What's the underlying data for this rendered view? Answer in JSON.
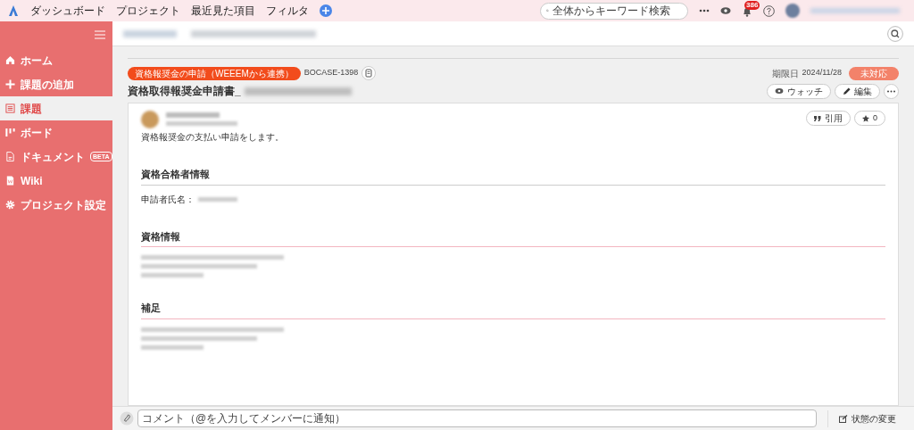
{
  "top_nav": {
    "items": [
      "ダッシュボード",
      "プロジェクト",
      "最近見た項目",
      "フィルタ"
    ],
    "search": {
      "placeholder": "全体からキーワード検索"
    },
    "notification_count": "386"
  },
  "sidebar": {
    "items": [
      {
        "label": "ホーム",
        "selected": false
      },
      {
        "label": "課題の追加",
        "selected": false
      },
      {
        "label": "課題",
        "selected": true
      },
      {
        "label": "ボード",
        "selected": false
      },
      {
        "label": "ドキュメント",
        "badge": "BETA",
        "selected": false
      },
      {
        "label": "Wiki",
        "selected": false
      },
      {
        "label": "プロジェクト設定",
        "selected": false
      }
    ]
  },
  "issue": {
    "category": "資格報奨金の申請（WEEEMから連携）",
    "key": "BOCASE-1398",
    "title": "資格取得報奨金申請書_",
    "due_label": "期限日",
    "due_date": "2024/11/28",
    "status": "未対応",
    "actions": [
      "ウォッチ",
      "編集"
    ],
    "description": "資格報奨金の支払い申請をします。",
    "quote_button": "引用",
    "star_count": "0",
    "sections": [
      {
        "heading": "資格合格者情報",
        "kind": "gray",
        "fields": [
          "申請者氏名："
        ]
      },
      {
        "heading": "資格情報",
        "kind": "pink"
      },
      {
        "heading": "補足",
        "kind": "pink"
      }
    ]
  },
  "comment_bar": {
    "placeholder": "コメント（@を入力してメンバーに通知）",
    "status_button": "状態の変更"
  }
}
